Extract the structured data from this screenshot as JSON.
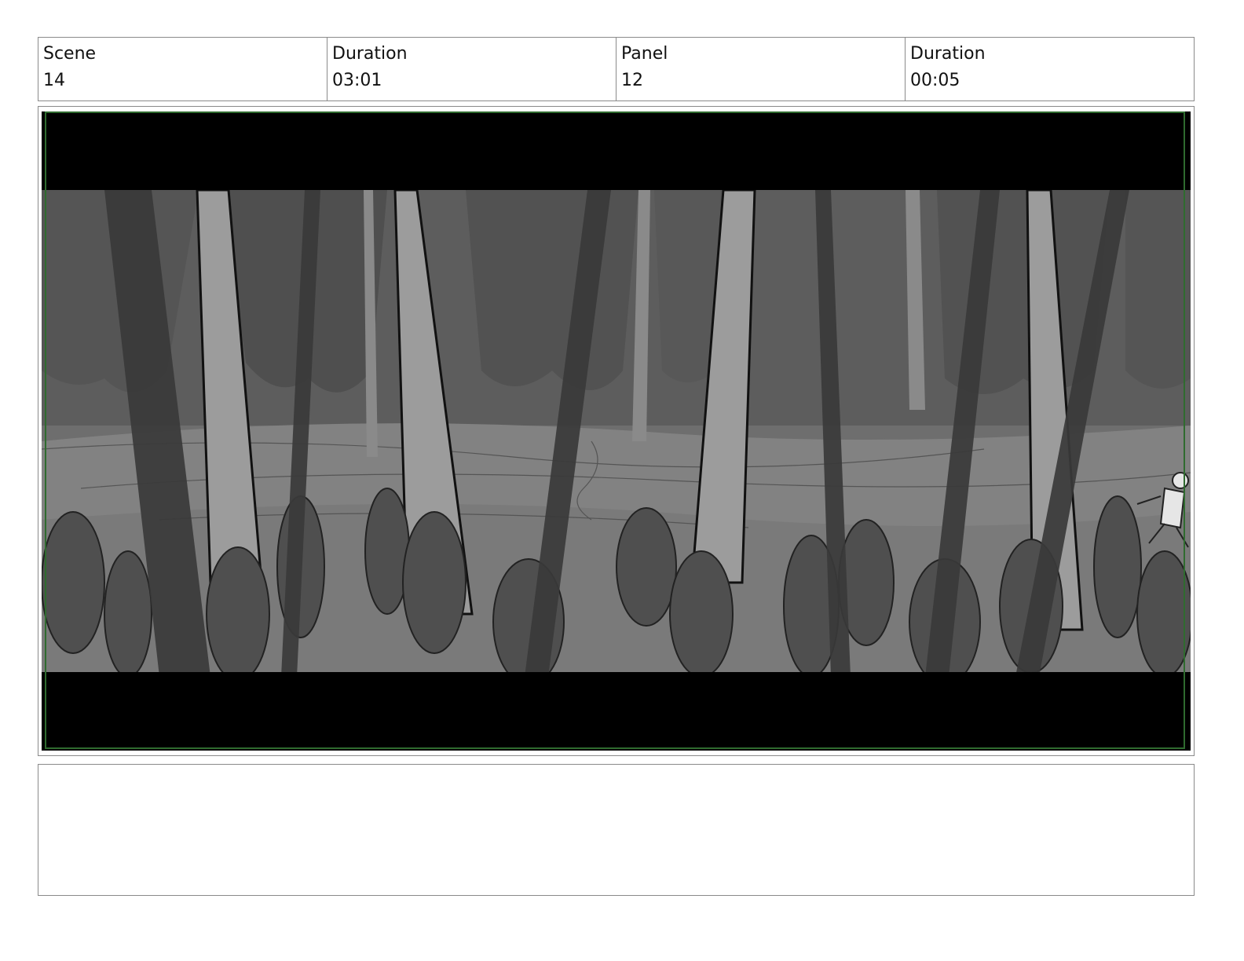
{
  "header": {
    "scene_label": "Scene",
    "scene_value": "14",
    "duration_label": "Duration",
    "duration_value": "03:01",
    "panel_label": "Panel",
    "panel_value": "12",
    "panel_duration_label": "Duration",
    "panel_duration_value": "00:05"
  },
  "notes": {
    "text": ""
  }
}
